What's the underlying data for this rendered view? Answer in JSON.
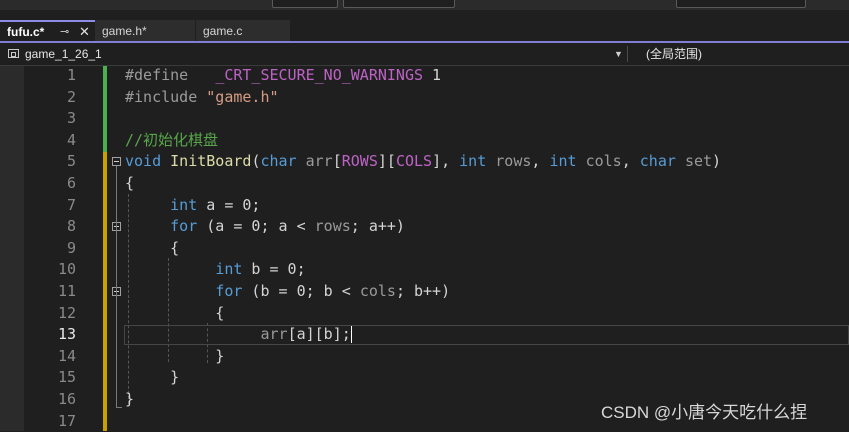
{
  "tabs": [
    {
      "label": "fufu.c*",
      "active": true
    },
    {
      "label": "game.h*",
      "active": false
    },
    {
      "label": "game.c",
      "active": false
    }
  ],
  "tab_icons": {
    "pin": "pin-icon",
    "close": "close-icon"
  },
  "navbar": {
    "project": "game_1_26_1",
    "scope": "(全局范围)"
  },
  "editor": {
    "current_line": 13,
    "lines": [
      {
        "no": "1",
        "tokens": [
          {
            "t": "#define",
            "c": "pp"
          },
          {
            "t": "   "
          },
          {
            "t": "_CRT_SECURE_NO_WARNINGS",
            "c": "macro"
          },
          {
            "t": " 1"
          }
        ]
      },
      {
        "no": "2",
        "tokens": [
          {
            "t": "#include ",
            "c": "pp"
          },
          {
            "t": "\"game.h\"",
            "c": "str"
          }
        ]
      },
      {
        "no": "3",
        "tokens": []
      },
      {
        "no": "4",
        "tokens": [
          {
            "t": "//初始化棋盘",
            "c": "cmt"
          }
        ]
      },
      {
        "no": "5",
        "tokens": [
          {
            "t": "void",
            "c": "kw"
          },
          {
            "t": " "
          },
          {
            "t": "InitBoard",
            "c": "fn"
          },
          {
            "t": "("
          },
          {
            "t": "char",
            "c": "kw"
          },
          {
            "t": " "
          },
          {
            "t": "arr",
            "c": "param"
          },
          {
            "t": "["
          },
          {
            "t": "ROWS",
            "c": "macro"
          },
          {
            "t": "]["
          },
          {
            "t": "COLS",
            "c": "macro"
          },
          {
            "t": "], "
          },
          {
            "t": "int",
            "c": "kw"
          },
          {
            "t": " "
          },
          {
            "t": "rows",
            "c": "param"
          },
          {
            "t": ", "
          },
          {
            "t": "int",
            "c": "kw"
          },
          {
            "t": " "
          },
          {
            "t": "cols",
            "c": "param"
          },
          {
            "t": ", "
          },
          {
            "t": "char",
            "c": "kw"
          },
          {
            "t": " "
          },
          {
            "t": "set",
            "c": "param"
          },
          {
            "t": ")"
          }
        ]
      },
      {
        "no": "6",
        "tokens": [
          {
            "t": "{"
          }
        ]
      },
      {
        "no": "7",
        "tokens": [
          {
            "t": "     "
          },
          {
            "t": "int",
            "c": "kw"
          },
          {
            "t": " a = 0;"
          }
        ]
      },
      {
        "no": "8",
        "tokens": [
          {
            "t": "     "
          },
          {
            "t": "for",
            "c": "kw"
          },
          {
            "t": " (a = 0; a < "
          },
          {
            "t": "rows",
            "c": "param"
          },
          {
            "t": "; a++)"
          }
        ]
      },
      {
        "no": "9",
        "tokens": [
          {
            "t": "     {"
          }
        ]
      },
      {
        "no": "10",
        "tokens": [
          {
            "t": "          "
          },
          {
            "t": "int",
            "c": "kw"
          },
          {
            "t": " b = 0;"
          }
        ]
      },
      {
        "no": "11",
        "tokens": [
          {
            "t": "          "
          },
          {
            "t": "for",
            "c": "kw"
          },
          {
            "t": " (b = 0; b < "
          },
          {
            "t": "cols",
            "c": "param"
          },
          {
            "t": "; b++)"
          }
        ]
      },
      {
        "no": "12",
        "tokens": [
          {
            "t": "          {"
          }
        ]
      },
      {
        "no": "13",
        "tokens": [
          {
            "t": "               "
          },
          {
            "t": "arr",
            "c": "param"
          },
          {
            "t": "[a][b];"
          }
        ]
      },
      {
        "no": "14",
        "tokens": [
          {
            "t": "          }"
          }
        ]
      },
      {
        "no": "15",
        "tokens": [
          {
            "t": "     }"
          }
        ]
      },
      {
        "no": "16",
        "tokens": [
          {
            "t": "}"
          }
        ]
      },
      {
        "no": "17",
        "tokens": []
      }
    ]
  },
  "watermark": "CSDN @小唐今天吃什么捏",
  "colors": {
    "keyword": "#569cd6",
    "macro": "#bd63c5",
    "string": "#d69d85",
    "comment": "#57a64a",
    "function": "#dcdcaa",
    "tab_accent": "#7f7fd6"
  }
}
